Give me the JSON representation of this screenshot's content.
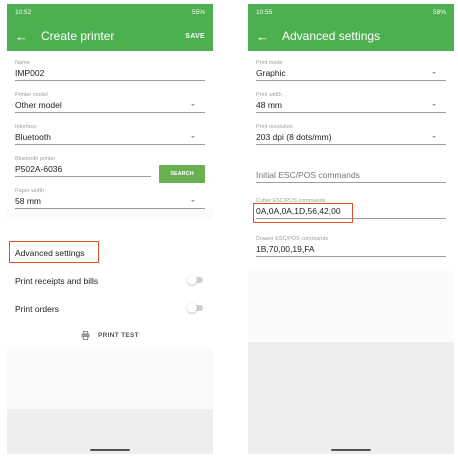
{
  "left": {
    "status": {
      "time": "10:52 ",
      "right": "55%"
    },
    "appbar": {
      "back": "←",
      "title": "Create printer",
      "action": "SAVE"
    },
    "fields": {
      "name": {
        "label": "Name",
        "value": "IMP002"
      },
      "model": {
        "label": "Printer model",
        "value": "Other model"
      },
      "interface": {
        "label": "Interface",
        "value": "Bluetooth"
      },
      "bt_printer": {
        "label": "Bluetooth printer",
        "value": "P502A-6036",
        "button": "SEARCH"
      },
      "paper": {
        "label": "Paper width",
        "value": "58 mm"
      }
    },
    "advanced": "Advanced settings",
    "receipts": {
      "label": "Print receipts and bills",
      "on": false
    },
    "orders": {
      "label": "Print orders",
      "on": false
    },
    "print_test": "PRINT TEST"
  },
  "right": {
    "status": {
      "time": "10:55 ",
      "right": "58%"
    },
    "appbar": {
      "back": "←",
      "title": "Advanced settings"
    },
    "fields": {
      "mode": {
        "label": "Print mode",
        "value": "Graphic"
      },
      "width": {
        "label": "Print width",
        "value": "48 mm"
      },
      "resolution": {
        "label": "Print resolution",
        "value": "203 dpi (8 dots/mm)"
      },
      "initial": {
        "placeholder": "Initial ESC/POS commands"
      },
      "cutter": {
        "label": "Cutter ESC/POS commands",
        "value": "0A,0A,0A,1D,56,42,00"
      },
      "drawer": {
        "label": "Drawer ESC/POS commands",
        "value": "1B,70,00,19,FA"
      }
    }
  },
  "colors": {
    "accent": "#4caf50",
    "highlight": "#e0502a",
    "button": "#6aae52"
  },
  "icons": [
    "back-arrow-icon",
    "caret-down-icon",
    "printer-icon",
    "toggle-switch",
    "wifi-icon",
    "battery-icon"
  ]
}
